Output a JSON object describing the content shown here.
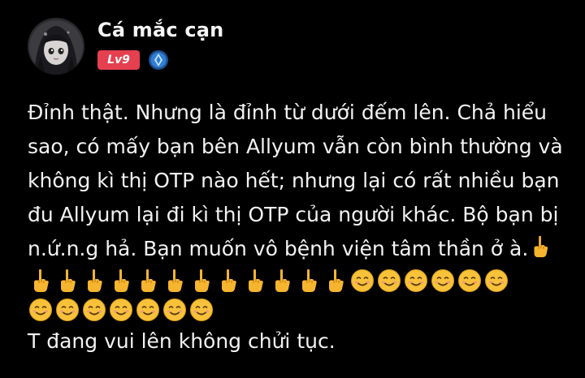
{
  "user": {
    "name": "Cá mắc cạn",
    "level": "Lv9",
    "level_color": "#e5404f",
    "verify_icon": "blue-shield-check-icon",
    "avatar_icon": "anime-avatar"
  },
  "post": {
    "text": "Đỉnh thật. Nhưng là đỉnh từ dưới đếm lên. Chả hiểu sao, có mấy bạn bên Allyum vẫn còn bình thường và không kì thị OTP nào hết; nhưng lại có rất nhiều bạn đu Allyum lại đi kì thị OTP của người khác. Bộ bạn bị n.ứ.n.g hả. Bạn muốn vô bệnh viện tâm thần ở à.",
    "emojis_inline": [
      "middle-finger-emoji"
    ],
    "emoji_row_1": [
      "middle-finger-emoji",
      "middle-finger-emoji",
      "middle-finger-emoji",
      "middle-finger-emoji",
      "middle-finger-emoji",
      "middle-finger-emoji",
      "middle-finger-emoji",
      "middle-finger-emoji",
      "middle-finger-emoji",
      "middle-finger-emoji",
      "middle-finger-emoji",
      "middle-finger-emoji",
      "smiling-face-emoji",
      "smiling-face-emoji",
      "smiling-face-emoji",
      "smiling-face-emoji",
      "smiling-face-emoji",
      "smiling-face-emoji"
    ],
    "emoji_row_2": [
      "smiling-face-emoji",
      "smiling-face-emoji",
      "smiling-face-emoji",
      "smiling-face-emoji",
      "smiling-face-emoji",
      "smiling-face-emoji",
      "smiling-face-emoji"
    ],
    "closing_line": "T đang vui lên không chửi tục."
  }
}
